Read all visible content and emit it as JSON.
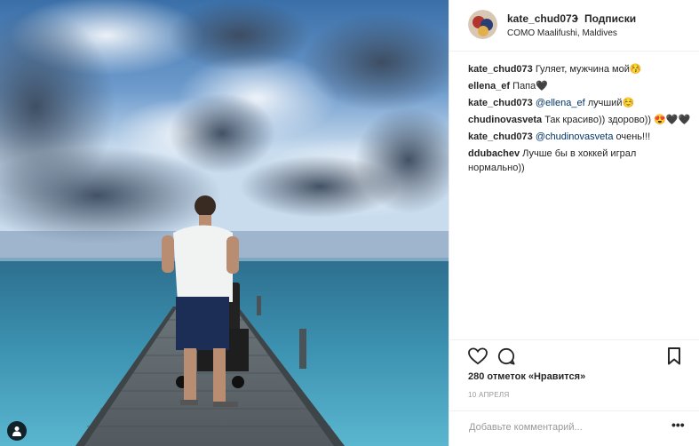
{
  "post": {
    "username": "kate_chud073",
    "separator": "•",
    "follow_label": "Подписки",
    "location": "COMO Maalifushi, Maldives"
  },
  "comments": [
    {
      "user": "kate_chud073",
      "parts": [
        {
          "text": "Гуляет, мужчина мой😚",
          "mention": false
        }
      ]
    },
    {
      "user": "ellena_ef",
      "parts": [
        {
          "text": "Папа🖤",
          "mention": false
        }
      ]
    },
    {
      "user": "kate_chud073",
      "parts": [
        {
          "text": "@ellena_ef",
          "mention": true
        },
        {
          "text": " лучший☺️",
          "mention": false
        }
      ]
    },
    {
      "user": "chudinovasveta",
      "parts": [
        {
          "text": "Так красиво)) здорово)) 😍🖤🖤",
          "mention": false
        }
      ]
    },
    {
      "user": "kate_chud073",
      "parts": [
        {
          "text": "@chudinovasveta",
          "mention": true
        },
        {
          "text": " очень!!!",
          "mention": false
        }
      ]
    },
    {
      "user": "ddubachev",
      "parts": [
        {
          "text": "Лучше бы в хоккей играл нормально))",
          "mention": false
        }
      ]
    }
  ],
  "likes_text": "280 отметок «Нравится»",
  "date": "10 АПРЕЛЯ",
  "comment_input": {
    "placeholder": "Добавьте комментарий..."
  },
  "more_label": "•••",
  "icons": [
    "heart-icon",
    "comment-icon",
    "bookmark-icon",
    "user-tag-icon"
  ]
}
